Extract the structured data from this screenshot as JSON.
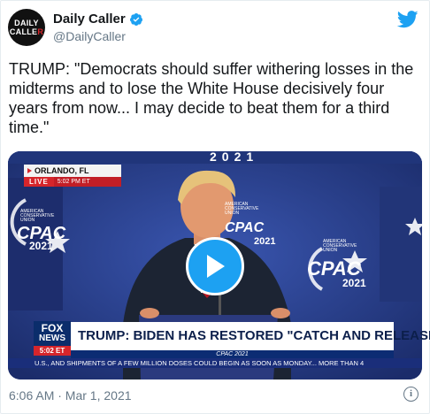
{
  "tweet": {
    "avatar": {
      "line1": "DAILY",
      "line2a": "CALLE",
      "line2b": "R"
    },
    "display_name": "Daily Caller",
    "handle": "@DailyCaller",
    "text": "TRUMP: \"Democrats should suffer withering losses in the midterms and to lose the White House decisively four years from now... I may decide to beat them for a third time.\"",
    "timestamp": "6:06 AM · Mar 1, 2021"
  },
  "video": {
    "location": "ORLANDO, FL",
    "live_label": "LIVE",
    "live_time": "5:02 PM ET",
    "fox_line1": "FOX",
    "fox_line2": "NEWS",
    "fox_time": "5:02 ET",
    "headline": "TRUMP: BIDEN HAS RESTORED \"CATCH AND RELEASE\"",
    "subline": "CPAC 2021",
    "ticker": "U.S., AND SHIPMENTS OF A FEW MILLION DOSES COULD BEGIN AS SOON AS MONDAY...   MORE THAN 4",
    "cpac_word": "CPAC",
    "cpac_year": "2021",
    "cpac_org": "AMERICAN CONSERVATIVE UNION",
    "top_text": "2021"
  },
  "colors": {
    "twitter_blue": "#1da1f2",
    "stage_blue": "#2a3f88",
    "fox_red": "#d6252b"
  },
  "icons": [
    "verified-badge-icon",
    "twitter-bird-icon",
    "play-icon",
    "info-icon"
  ]
}
